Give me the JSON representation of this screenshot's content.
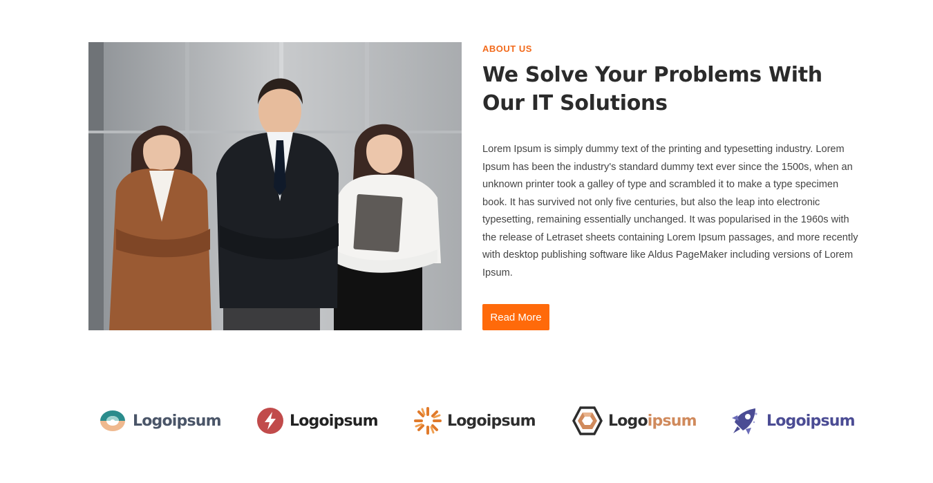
{
  "about": {
    "eyebrow": "ABOUT US",
    "title": "We Solve Your Problems With Our IT Solutions",
    "body": "Lorem Ipsum is simply dummy text of the printing and typesetting industry. Lorem Ipsum has been the industry's standard dummy text ever since the 1500s, when an unknown printer took a galley of type and scrambled it to make a type specimen book. It has survived not only five centuries, but also the leap into electronic typesetting, remaining essentially unchanged. It was popularised in the 1960s with the release of Letraset sheets containing Lorem Ipsum passages, and more recently with desktop publishing software like Aldus PageMaker including versions of Lorem Ipsum.",
    "button_label": "Read More"
  },
  "logos": [
    {
      "name": "Logoipsum",
      "icon": "ring-logo-icon",
      "color": "#4a5568"
    },
    {
      "name": "Logoipsum",
      "icon": "bolt-logo-icon",
      "color": "#222222"
    },
    {
      "name": "Logoipsum",
      "icon": "sun-logo-icon",
      "color": "#2d2d2d"
    },
    {
      "name": "Logo",
      "name_accent": "ipsum",
      "icon": "hexagon-logo-icon",
      "color": "#2d2d2d",
      "accent_color": "#d08a5c"
    },
    {
      "name": "Logoipsum",
      "icon": "rocket-logo-icon",
      "color": "#4b4c94"
    }
  ],
  "colors": {
    "accent": "#f26a1b",
    "button": "#ff6a0a"
  }
}
